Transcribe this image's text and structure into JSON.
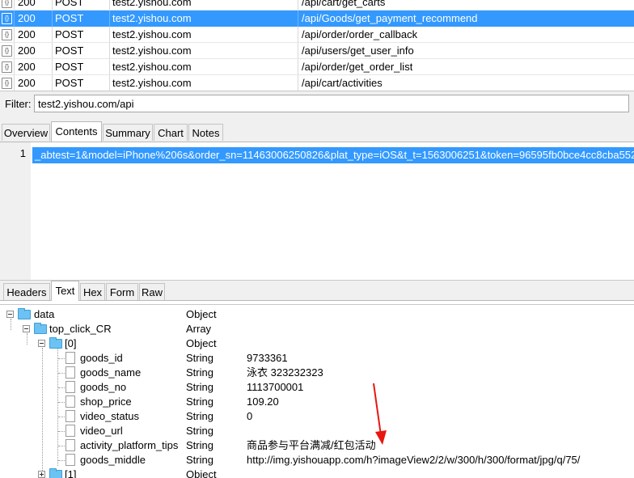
{
  "request_list": [
    {
      "result": "200",
      "method": "POST",
      "host": "test2.yishou.com",
      "path": "/api/cart/get_carts",
      "selected": false
    },
    {
      "result": "200",
      "method": "POST",
      "host": "test2.yishou.com",
      "path": "/api/Goods/get_payment_recommend",
      "selected": true
    },
    {
      "result": "200",
      "method": "POST",
      "host": "test2.yishou.com",
      "path": "/api/order/order_callback",
      "selected": false
    },
    {
      "result": "200",
      "method": "POST",
      "host": "test2.yishou.com",
      "path": "/api/users/get_user_info",
      "selected": false
    },
    {
      "result": "200",
      "method": "POST",
      "host": "test2.yishou.com",
      "path": "/api/order/get_order_list",
      "selected": false
    },
    {
      "result": "200",
      "method": "POST",
      "host": "test2.yishou.com",
      "path": "/api/cart/activities",
      "selected": false
    }
  ],
  "request_icon": "json-doc-icon",
  "filter": {
    "label": "Filter:",
    "value": "test2.yishou.com/api"
  },
  "top_tabs": [
    "Overview",
    "Contents",
    "Summary",
    "Chart",
    "Notes"
  ],
  "top_tabs_active": "Contents",
  "body_editor": {
    "line_number": "1",
    "text": "_abtest=1&model=iPhone%206s&order_sn=11463006250826&plat_type=iOS&t_t=1563006251&token=96595fb0bce4cc8cba552"
  },
  "bottom_tabs": [
    "Headers",
    "Text",
    "Hex",
    "Form",
    "Raw"
  ],
  "bottom_tabs_active": "Text",
  "tree": [
    {
      "name": "data",
      "type": "Object",
      "value": ""
    },
    {
      "name": "top_click_CR",
      "type": "Array",
      "value": ""
    },
    {
      "name": "[0]",
      "type": "Object",
      "value": ""
    },
    {
      "name": "goods_id",
      "type": "String",
      "value": "9733361"
    },
    {
      "name": "goods_name",
      "type": "String",
      "value": "泳衣 323232323"
    },
    {
      "name": "goods_no",
      "type": "String",
      "value": "1113700001"
    },
    {
      "name": "shop_price",
      "type": "String",
      "value": "109.20"
    },
    {
      "name": "video_status",
      "type": "String",
      "value": "0"
    },
    {
      "name": "video_url",
      "type": "String",
      "value": ""
    },
    {
      "name": "activity_platform_tips",
      "type": "String",
      "value": "商品参与平台满减/红包活动"
    },
    {
      "name": "goods_middle",
      "type": "String",
      "value": "http://img.yishouapp.com/h?imageView2/2/w/300/h/300/format/jpg/q/75/"
    },
    {
      "name": "[1]",
      "type": "Object",
      "value": ""
    }
  ],
  "colors": {
    "selection": "#3399ff",
    "annotation_arrow": "#e8160f",
    "folder": "#6cc2f2"
  }
}
